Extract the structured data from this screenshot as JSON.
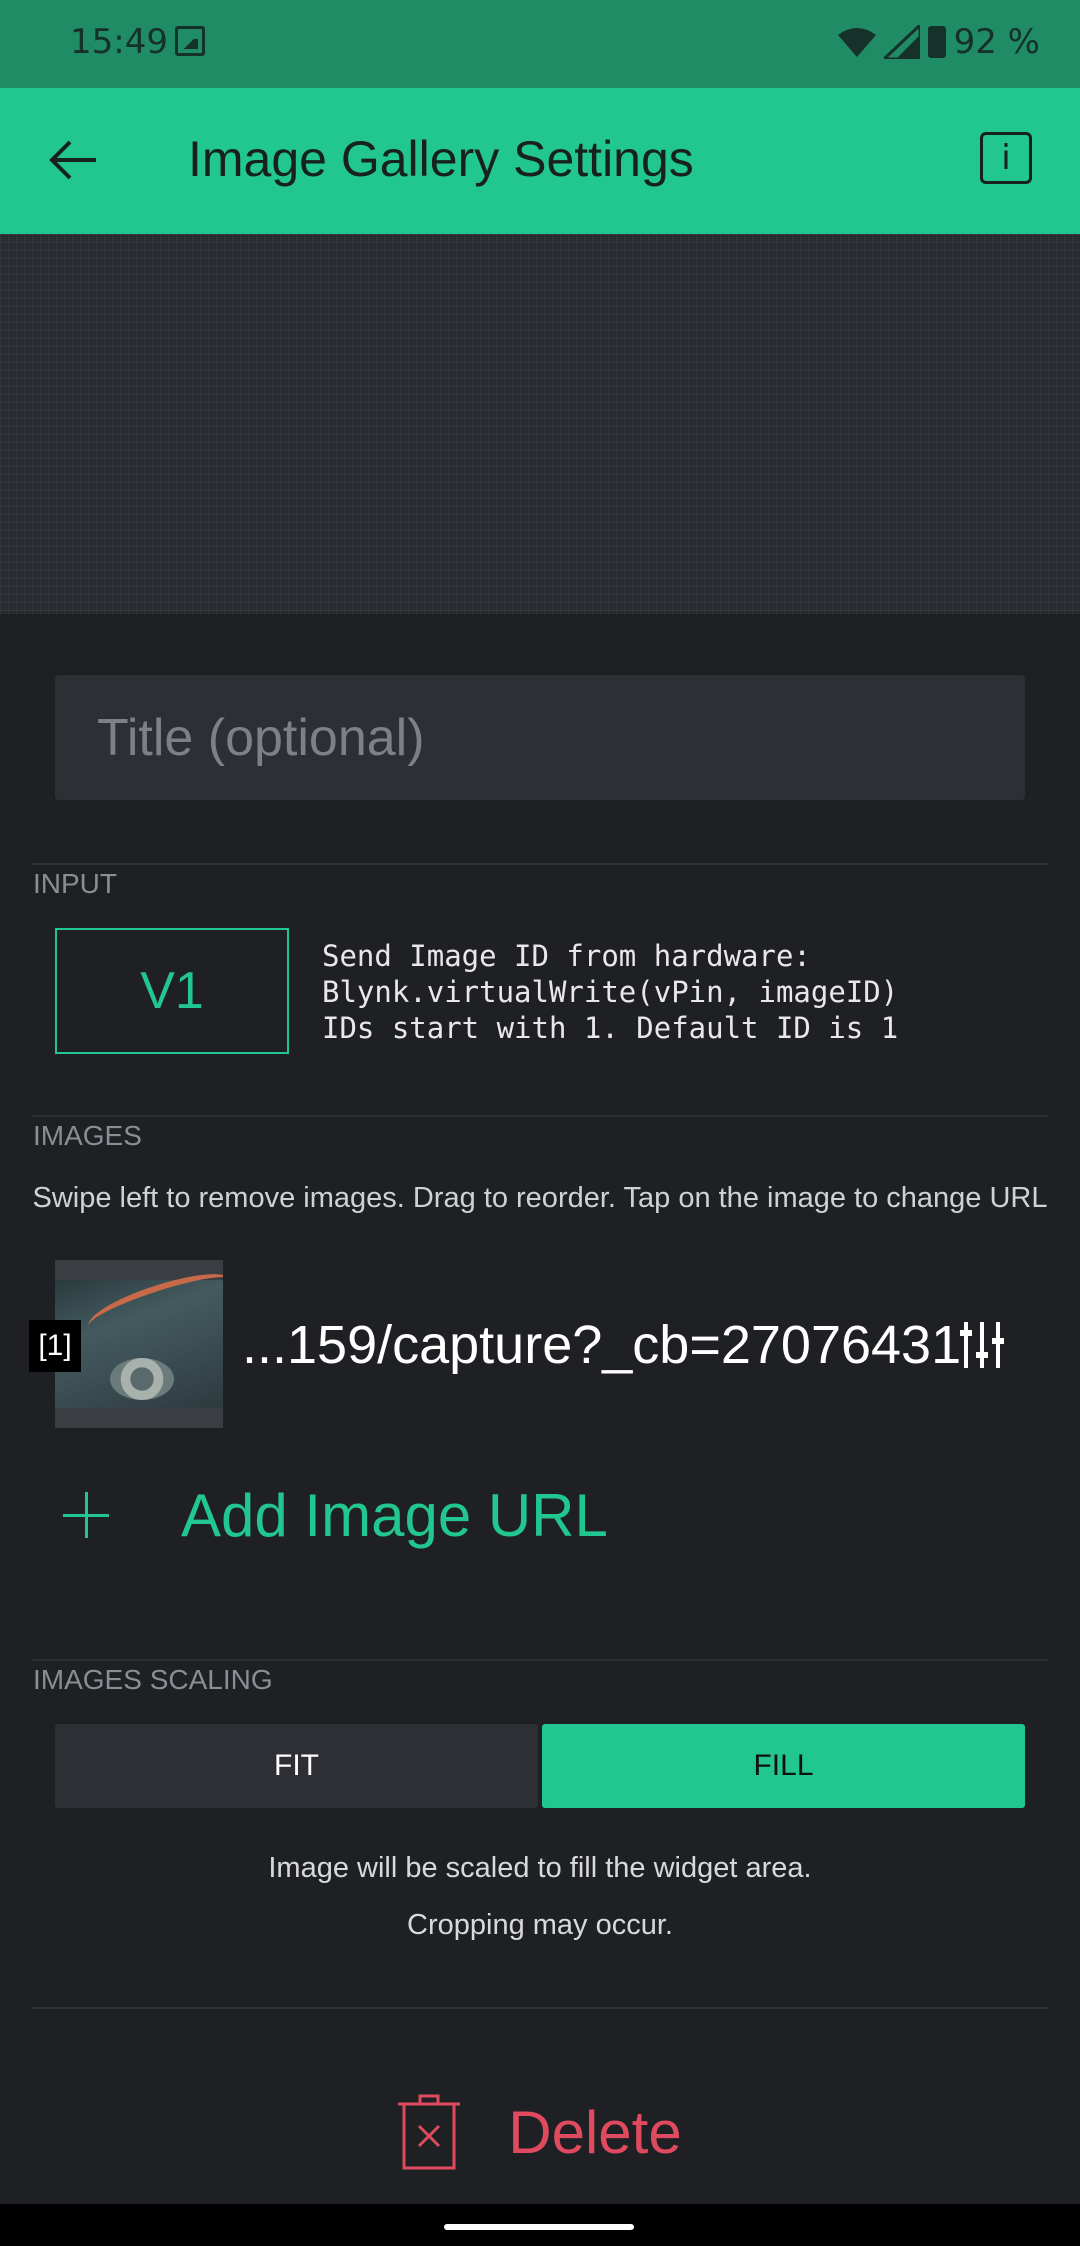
{
  "status_bar": {
    "time": "15:49",
    "battery": "92 %"
  },
  "app_bar": {
    "title": "Image Gallery Settings",
    "info_label": "i"
  },
  "title_field": {
    "placeholder": "Title (optional)"
  },
  "input_section": {
    "label": "INPUT",
    "pin": "V1",
    "help": "Send Image ID from hardware:\nBlynk.virtualWrite(vPin, imageID)\nIDs start with 1. Default ID is 1"
  },
  "images_section": {
    "label": "IMAGES",
    "hint": "Swipe left to remove images. Drag to reorder. Tap on the image to change URL",
    "items": [
      {
        "index": "[1]",
        "url": "...159/capture?_cb=27076431"
      }
    ],
    "add_label": "Add Image URL"
  },
  "scaling_section": {
    "label": "IMAGES SCALING",
    "options": [
      "FIT",
      "FILL"
    ],
    "selected": "FILL",
    "description_line1": "Image will be scaled to fill the widget area.",
    "description_line2": "Cropping may occur."
  },
  "delete": {
    "label": "Delete"
  },
  "colors": {
    "accent": "#22c68f",
    "danger": "#e04a5f",
    "background": "#1e2024"
  }
}
